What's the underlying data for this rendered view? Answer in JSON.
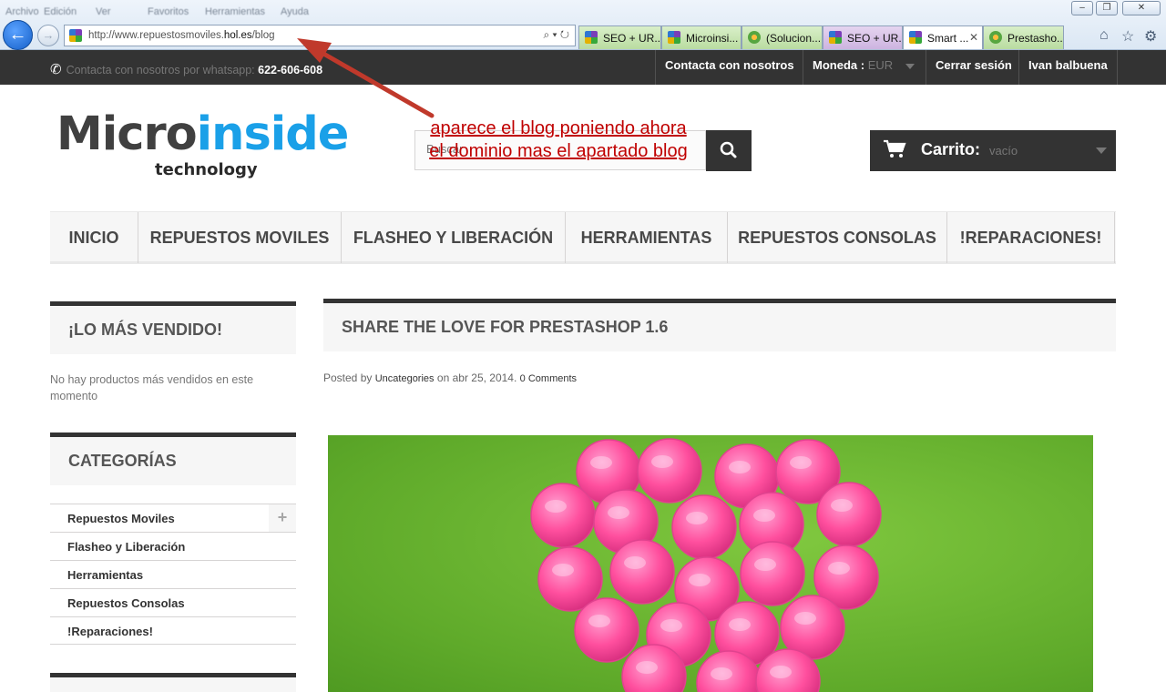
{
  "browser": {
    "menu": [
      "Archivo",
      "Edición",
      "Ver",
      "Favoritos",
      "Herramientas",
      "Ayuda"
    ],
    "window_controls": [
      "–",
      "❐",
      "✕"
    ],
    "url_prefix": "http://www.repuestosmoviles.",
    "url_domain": "hol.es",
    "url_path": "/blog",
    "url_actions": "⌕ ▾ ↻",
    "tabs": [
      {
        "label": "SEO + UR...",
        "icon": "puzzle-favicon"
      },
      {
        "label": "Microinsi...",
        "icon": "puzzle-favicon"
      },
      {
        "label": "(Solucion...",
        "icon": "prestashop-favicon"
      },
      {
        "label": "SEO + UR...",
        "icon": "puzzle-favicon"
      },
      {
        "label": "Smart ...",
        "icon": "puzzle-favicon",
        "active": true
      },
      {
        "label": "Prestasho...",
        "icon": "prestashop-favicon"
      }
    ],
    "tab_close": "✕",
    "toolbar_icons": {
      "home": "⌂",
      "favorites": "☆",
      "tools": "⚙"
    }
  },
  "topbar": {
    "whatsapp_label": "Contacta con nosotros por whatsapp:",
    "whatsapp_number": "622-606-608",
    "contact": "Contacta con nosotros",
    "currency_label": "Moneda :",
    "currency_value": "EUR",
    "logout": "Cerrar sesión",
    "user": "Ivan balbuena"
  },
  "header": {
    "logo_part1": "Micro",
    "logo_part2": "inside",
    "logo_sub": "technology",
    "search_placeholder": "Buscar",
    "cart_label": "Carrito:",
    "cart_status": "vacío"
  },
  "annotation": {
    "text": "aparece el blog poniendo ahora el dominio mas el apartado blog",
    "color": "#c00000"
  },
  "menu": [
    "INICIO",
    "REPUESTOS MOVILES",
    "FLASHEO Y LIBERACIÓN",
    "HERRAMIENTAS",
    "REPUESTOS CONSOLAS",
    "!REPARACIONES!"
  ],
  "sidebar": {
    "bestsellers_title": "¡LO MÁS VENDIDO!",
    "bestsellers_empty": "No hay productos más vendidos en este momento",
    "categories_title": "CATEGORÍAS",
    "categories": [
      "Repuestos Moviles",
      "Flasheo y Liberación",
      "Herramientas",
      "Repuestos Consolas",
      "!Reparaciones!"
    ],
    "expand_symbol": "+"
  },
  "post": {
    "title": "SHARE THE LOVE FOR PRESTASHOP 1.6",
    "posted_by": "Posted by",
    "category": "Uncategories",
    "on": "on",
    "date": "abr 25, 2014.",
    "comments": "0 Comments"
  },
  "colors": {
    "topbar": "#333333",
    "logo_blue": "#1aa0e8",
    "image_green": "#6cb830",
    "pill_pink": "#ff5fa2"
  }
}
